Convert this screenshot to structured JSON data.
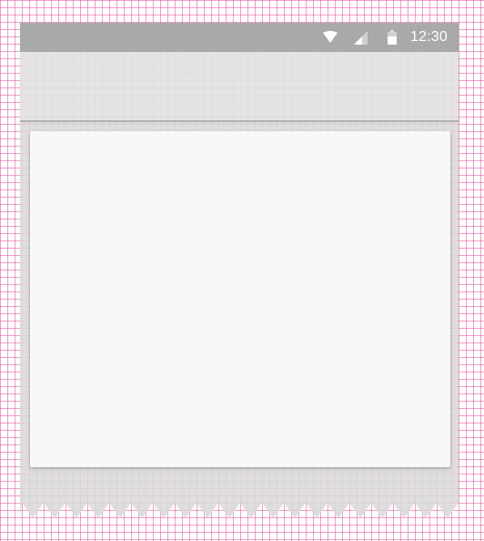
{
  "status_bar": {
    "time": "12:30",
    "icons": [
      "wifi-icon",
      "cellular-signal-icon",
      "battery-icon"
    ]
  },
  "colors": {
    "status_bar": "#a9a9a9",
    "app_bar": "#e2e2e2",
    "background": "#dadada",
    "card": "#fcfcfc",
    "grid": "#e150a0"
  }
}
